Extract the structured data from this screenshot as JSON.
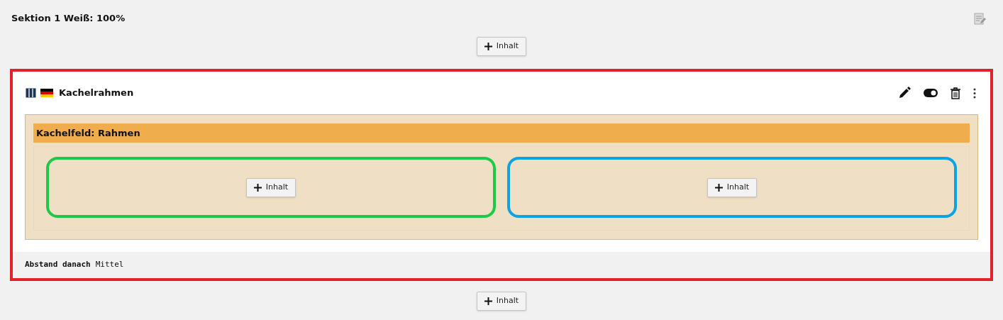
{
  "section": {
    "title": "Sektion 1 Weiß: 100%"
  },
  "add_button_top": {
    "label": "Inhalt"
  },
  "element": {
    "title": "Kachelrahmen",
    "grid": {
      "title": "Kachelfeld: Rahmen",
      "columns": [
        {
          "color": "#1ec94a",
          "add_button": {
            "label": "Inhalt"
          }
        },
        {
          "color": "#0aa3e3",
          "add_button": {
            "label": "Inhalt"
          }
        }
      ]
    },
    "footer": {
      "label": "Abstand danach",
      "value": "Mittel"
    }
  },
  "add_button_bottom": {
    "label": "Inhalt"
  }
}
